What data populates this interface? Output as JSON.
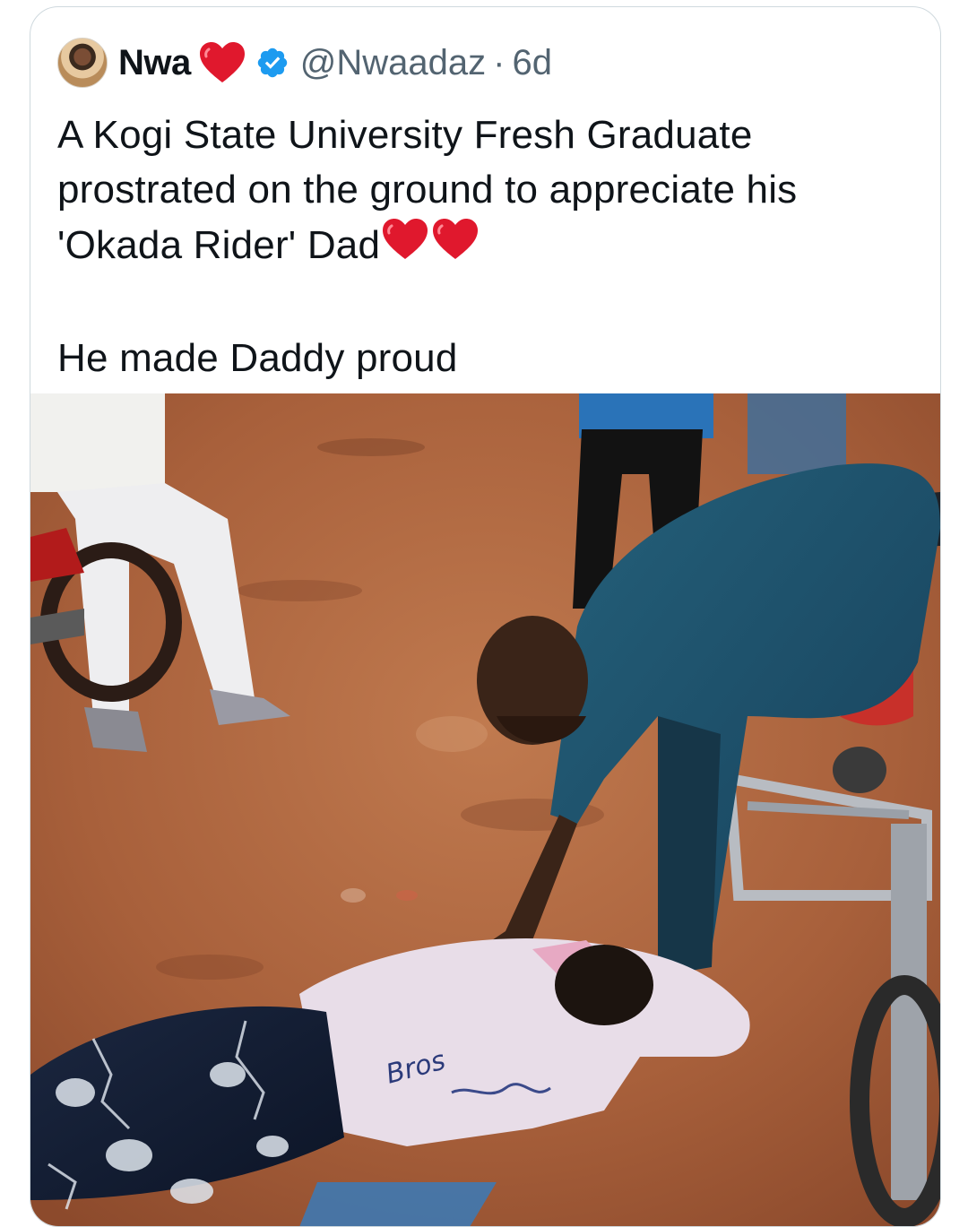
{
  "tweet": {
    "author_name": "Nwa",
    "handle": "@Nwaadaz",
    "separator": "·",
    "time": "6d",
    "text_lines": [
      "A Kogi State University Fresh Graduate",
      "prostrated on the ground to appreciate his",
      "'Okada Rider' Dad"
    ],
    "text_last": "He made Daddy proud",
    "heart_color": "#e0182d",
    "verified_color": "#1d9bf0"
  },
  "media": {
    "shirt_writing": "Bros"
  }
}
